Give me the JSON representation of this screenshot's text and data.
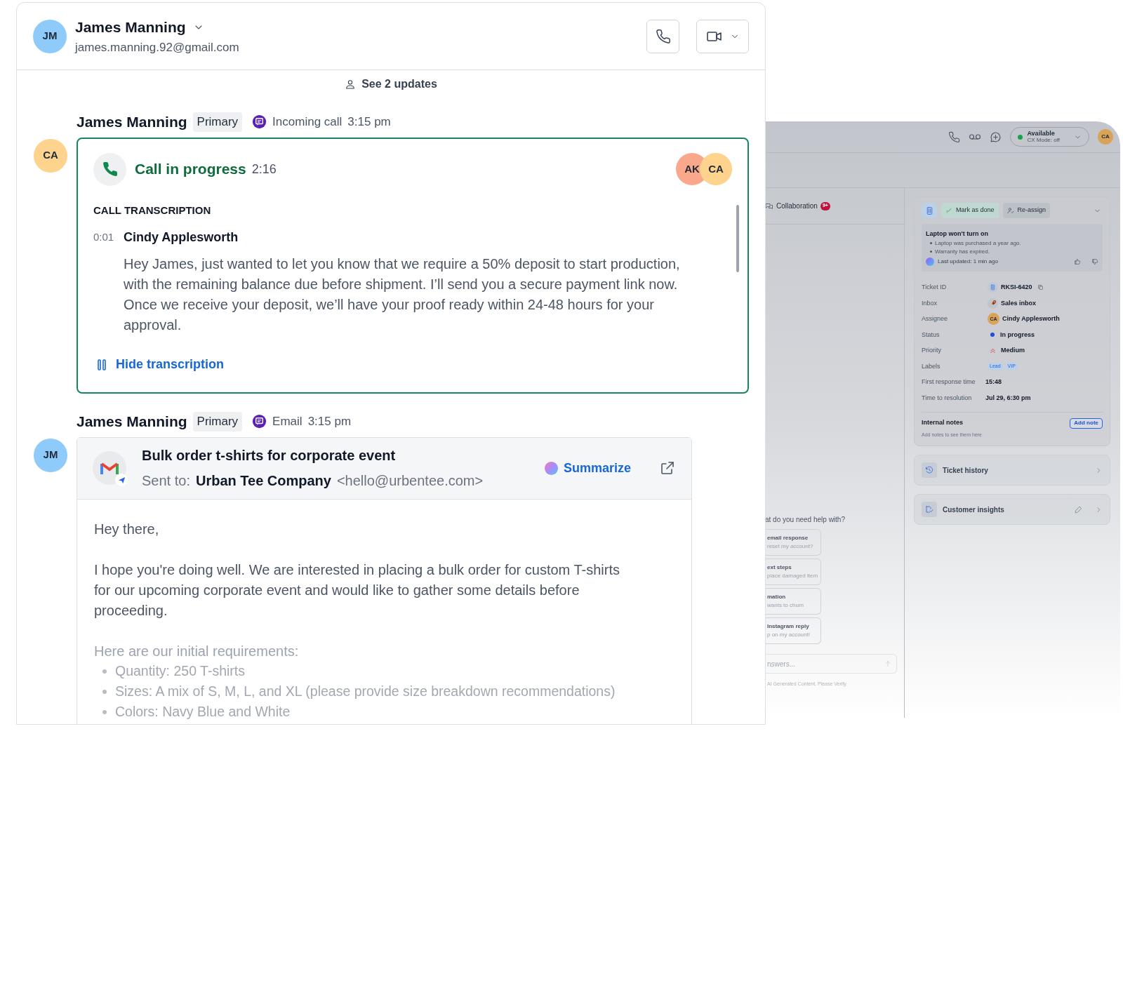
{
  "conversation": {
    "contact": {
      "initials": "JM",
      "color": "#8ecbfb",
      "name": "James Manning",
      "email": "james.manning.92@gmail.com"
    },
    "updates": "See 2 updates",
    "messages": [
      {
        "kind": "call",
        "avatar": {
          "initials": "CA",
          "color": "#fdd38e"
        },
        "sender": "James Manning",
        "badge": "Primary",
        "channel": "Incoming call",
        "time": "3:15 pm",
        "call": {
          "status": "Call in progress",
          "duration": "2:16",
          "participants": [
            {
              "initials": "AK",
              "color": "#f9a88c"
            },
            {
              "initials": "CA",
              "color": "#fdd38e"
            }
          ],
          "section": "CALL TRANSCRIPTION",
          "entries": [
            {
              "time": "0:01",
              "speaker": "Cindy Applesworth",
              "text": "Hey James, just wanted to let you know that we require a 50% deposit to start production, with the remaining balance due before shipment. I’ll send you a secure payment link now. Once we receive your deposit, we’ll have your proof ready within 24-48 hours for your approval."
            }
          ],
          "toggle": "Hide transcription"
        }
      },
      {
        "kind": "email",
        "avatar": {
          "initials": "JM",
          "color": "#8ecbfb"
        },
        "sender": "James Manning",
        "badge": "Primary",
        "channel": "Email",
        "time": "3:15 pm",
        "email": {
          "subject": "Bulk order t-shirts for corporate event",
          "sent_to_label": "Sent to:",
          "recipient": "Urban Tee Company",
          "address": "<hello@urbentee.com>",
          "action": "Summarize",
          "body": [
            {
              "kind": "paragraph",
              "text": "Hey there,"
            },
            {
              "kind": "paragraph",
              "text": "I hope you're doing well. We are interested in placing a bulk order for custom T-shirts for our upcoming corporate event and would like to gather some details before proceeding."
            },
            {
              "kind": "paragraph",
              "text": "Here are our initial requirements:"
            },
            {
              "kind": "bullet",
              "text": "Quantity: 250 T-shirts"
            },
            {
              "kind": "bullet",
              "text": "Sizes: A mix of S, M, L, and XL (please provide size breakdown recommendations)"
            },
            {
              "kind": "bullet",
              "text": "Colors: Navy Blue and White"
            }
          ]
        }
      }
    ]
  },
  "background_app": {
    "top_bar": {
      "status": "Available",
      "mode": "CX Mode: off",
      "avatar": "CA"
    },
    "collaboration": {
      "label": "Collaboration",
      "badge": "9+"
    },
    "assistant": {
      "prompt": "at do you need help with?",
      "suggestions": [
        {
          "title": "email response",
          "subtitle": "reset my account?"
        },
        {
          "title": "ext steps",
          "subtitle": "place damaged item"
        },
        {
          "title": "mation",
          "subtitle": "wants to churn"
        },
        {
          "title": "Instagram reply",
          "subtitle": "p on my account!"
        }
      ],
      "placeholder": "nswers...",
      "disclaimer": "AI Generated Content. Please Verify"
    },
    "ticket": {
      "actions": [
        "Mark as done",
        "Re-assign"
      ],
      "summary": {
        "title": "Laptop won't turn on",
        "points": [
          "Laptop was purchased a year ago.",
          "Warranty has expired."
        ],
        "updated": "Last updated: 1 min ago"
      },
      "fields": [
        {
          "kind": "ticket",
          "label": "Ticket ID",
          "value": "RKSI-6420"
        },
        {
          "kind": "inbox",
          "label": "Inbox",
          "value": "Sales inbox"
        },
        {
          "kind": "assignee",
          "label": "Assignee",
          "value": "Cindy Applesworth",
          "initials": "CA"
        },
        {
          "kind": "status",
          "label": "Status",
          "value": "In progress",
          "color": "#1d4ed8"
        },
        {
          "kind": "priority",
          "label": "Priority",
          "value": "Medium"
        },
        {
          "kind": "labels",
          "label": "Labels",
          "labels": [
            "Lead",
            "VIP"
          ]
        },
        {
          "kind": "plain",
          "label": "First response time",
          "value": "15:48"
        },
        {
          "kind": "plain",
          "label": "Time to resolution",
          "value": "Jul 29, 6:30 pm"
        }
      ],
      "notes": {
        "title": "Internal notes",
        "button": "Add note",
        "hint": "Add notes to see them here"
      },
      "sections": [
        {
          "kind": "history",
          "label": "Ticket history"
        },
        {
          "kind": "insights",
          "label": "Customer insights"
        }
      ]
    }
  }
}
